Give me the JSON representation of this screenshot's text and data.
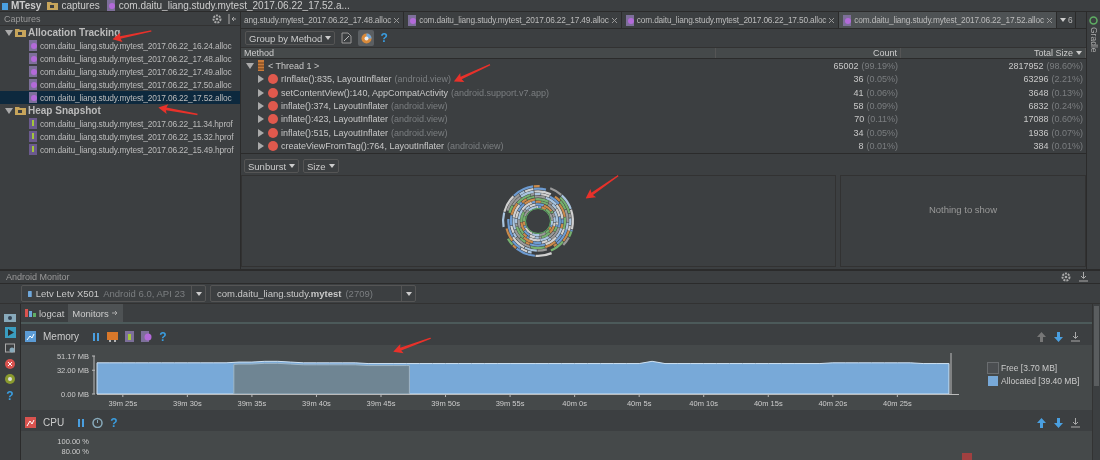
{
  "breadcrumb": [
    {
      "label": "MTesy",
      "kind": "project"
    },
    {
      "label": "captures",
      "kind": "folder"
    },
    {
      "label": "com.daitu_liang.study.mytest_2017.06.22_17.52.a...",
      "kind": "file"
    }
  ],
  "captures": {
    "title": "Captures",
    "groups": [
      {
        "label": "Allocation Tracking",
        "expanded": true,
        "children": [
          {
            "label": "com.daitu_liang.study.mytest_2017.06.22_16.24.alloc",
            "kind": "alloc",
            "selected": false
          },
          {
            "label": "com.daitu_liang.study.mytest_2017.06.22_17.48.alloc",
            "kind": "alloc",
            "selected": false
          },
          {
            "label": "com.daitu_liang.study.mytest_2017.06.22_17.49.alloc",
            "kind": "alloc",
            "selected": false
          },
          {
            "label": "com.daitu_liang.study.mytest_2017.06.22_17.50.alloc",
            "kind": "alloc",
            "selected": false
          },
          {
            "label": "com.daitu_liang.study.mytest_2017.06.22_17.52.alloc",
            "kind": "alloc",
            "selected": true
          }
        ]
      },
      {
        "label": "Heap Snapshot",
        "expanded": true,
        "children": [
          {
            "label": "com.daitu_liang.study.mytest_2017.06.22_11.34.hprof",
            "kind": "hprof",
            "selected": false
          },
          {
            "label": "com.daitu_liang.study.mytest_2017.06.22_15.32.hprof",
            "kind": "hprof",
            "selected": false
          },
          {
            "label": "com.daitu_liang.study.mytest_2017.06.22_15.49.hprof",
            "kind": "hprof",
            "selected": false
          }
        ]
      }
    ]
  },
  "editor_tabs": [
    {
      "label": "ang.study.mytest_2017.06.22_17.48.alloc",
      "selected": false
    },
    {
      "label": "com.daitu_liang.study.mytest_2017.06.22_17.49.alloc",
      "selected": false
    },
    {
      "label": "com.daitu_liang.study.mytest_2017.06.22_17.50.alloc",
      "selected": false
    },
    {
      "label": "com.daitu_liang.study.mytest_2017.06.22_17.52.alloc",
      "selected": true
    }
  ],
  "tab_overflow_count": "6",
  "toolbar": {
    "group_by": "Group by Method",
    "chart_toggle_on": true,
    "help": "?"
  },
  "table": {
    "columns": [
      "Method",
      "Count",
      "Total Size"
    ],
    "rows": [
      {
        "kind": "thread",
        "expanded": true,
        "name": "< Thread 1 >",
        "count": "65002",
        "count_pct": "(99.19%)",
        "size": "2817952",
        "size_pct": "(98.60%)"
      },
      {
        "kind": "method",
        "expanded": false,
        "name": "rInflate():835, LayoutInflater",
        "package": "(android.view)",
        "count": "36",
        "count_pct": "(0.05%)",
        "size": "63296",
        "size_pct": "(2.21%)"
      },
      {
        "kind": "method",
        "expanded": false,
        "name": "setContentView():140, AppCompatActivity",
        "package": "(android.support.v7.app)",
        "count": "41",
        "count_pct": "(0.06%)",
        "size": "3648",
        "size_pct": "(0.13%)"
      },
      {
        "kind": "method",
        "expanded": false,
        "name": "inflate():374, LayoutInflater",
        "package": "(android.view)",
        "count": "58",
        "count_pct": "(0.09%)",
        "size": "6832",
        "size_pct": "(0.24%)"
      },
      {
        "kind": "method",
        "expanded": false,
        "name": "inflate():423, LayoutInflater",
        "package": "(android.view)",
        "count": "70",
        "count_pct": "(0.11%)",
        "size": "17088",
        "size_pct": "(0.60%)"
      },
      {
        "kind": "method",
        "expanded": false,
        "name": "inflate():515, LayoutInflater",
        "package": "(android.view)",
        "count": "34",
        "count_pct": "(0.05%)",
        "size": "1936",
        "size_pct": "(0.07%)"
      },
      {
        "kind": "method",
        "expanded": false,
        "name": "createViewFromTag():764, LayoutInflater",
        "package": "(android.view)",
        "count": "8",
        "count_pct": "(0.01%)",
        "size": "384",
        "size_pct": "(0.01%)"
      }
    ]
  },
  "sunburst": {
    "mode": "Sunburst",
    "metric": "Size",
    "empty_text": "Nothing to show"
  },
  "side_strip": "Gradle",
  "monitor": {
    "title": "Android Monitor",
    "device": "Letv Letv X501",
    "device_detail": "Android 6.0, API 23",
    "process": "com.daitu_liang.study.**mytest**",
    "pid": "(2709)",
    "tabs": [
      {
        "label": "logcat",
        "selected": false
      },
      {
        "label": "Monitors",
        "selected": true
      }
    ],
    "memory": {
      "title": "Memory",
      "help": "?",
      "chart_data": {
        "type": "area",
        "categories": [
          null,
          null,
          "39m 25s",
          null,
          null,
          null,
          null,
          "39m 30s",
          null,
          null,
          null,
          null,
          "39m 35s",
          null,
          null,
          null,
          null,
          "39m 40s",
          null,
          null,
          null,
          null,
          "39m 45s",
          null,
          null,
          null,
          null,
          "39m 50s",
          null,
          null,
          null,
          null,
          "39m 55s",
          null,
          null,
          null,
          null,
          "40m 0s",
          null,
          null,
          null,
          null,
          "40m 5s",
          null,
          null,
          null,
          null,
          "40m 10s",
          null,
          null,
          null,
          null,
          "40m 15s",
          null,
          null,
          null,
          null,
          "40m 20s",
          null,
          null,
          null,
          null,
          "40m 25s",
          null,
          null,
          null,
          null
        ],
        "series": [
          {
            "name": "Allocated",
            "color": "#78a9d8",
            "values": [
              42,
              42,
              42,
              42,
              42,
              42,
              42,
              42,
              42,
              42,
              42,
              43,
              43,
              44,
              44,
              43,
              42,
              42,
              42,
              42,
              42,
              41,
              41,
              41,
              41,
              41,
              41,
              41,
              41,
              41,
              41,
              41,
              41,
              41,
              41,
              41,
              41,
              41,
              41,
              41,
              41,
              41,
              41,
              44,
              41,
              41,
              41,
              41,
              41,
              41,
              41,
              41,
              41,
              41,
              41,
              41,
              41,
              42,
              42,
              42,
              42,
              42,
              42,
              42,
              41,
              41,
              41
            ]
          }
        ],
        "ylim": [
          0,
          51.17
        ],
        "yticks": [
          {
            "value": 0,
            "label": "0.00 MB"
          },
          {
            "value": 32,
            "label": "32.00 MB"
          },
          {
            "value": 51.17,
            "label": "51.17 MB"
          }
        ],
        "xlabel": null
      },
      "legend": [
        {
          "name": "Free",
          "reading": "[3.70 MB]",
          "color": "#4b4e51"
        }
      ],
      "allocated_reading": "[39.40 MB]"
    },
    "cpu": {
      "title": "CPU",
      "help": "?",
      "y_labels": [
        "100.00 %",
        "80.00 %"
      ]
    }
  }
}
